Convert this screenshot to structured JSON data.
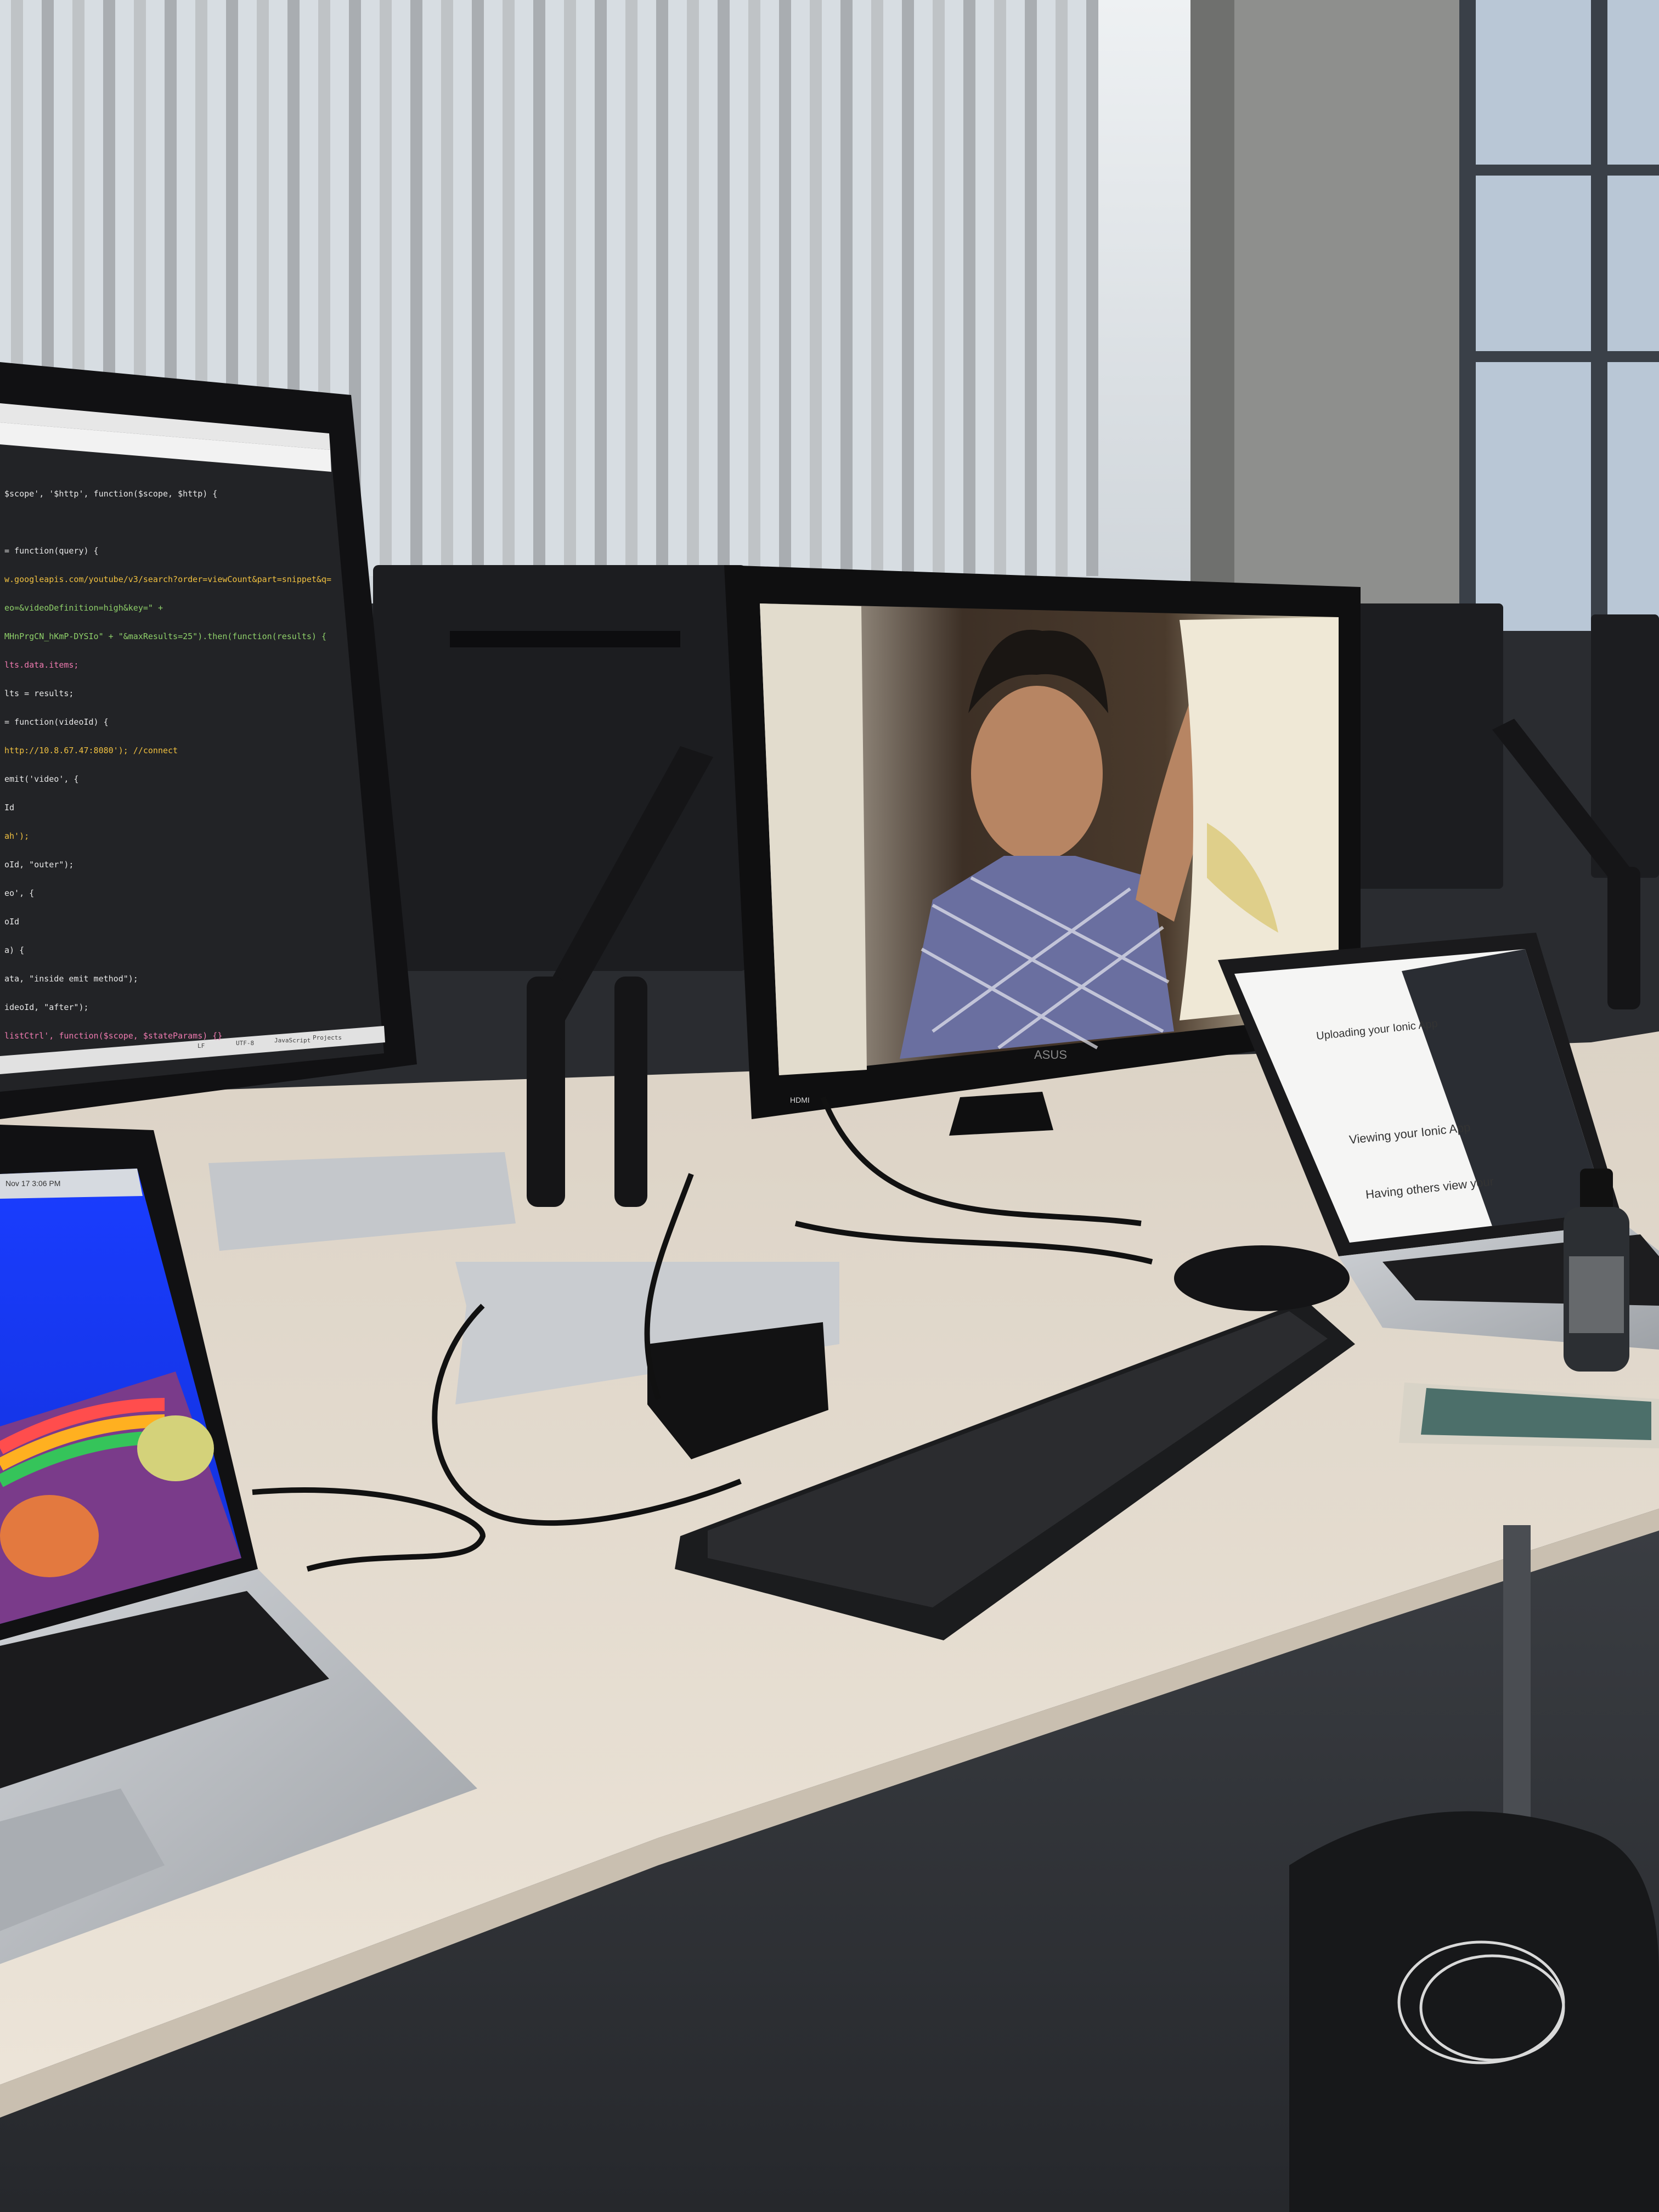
{
  "scene": {
    "description_colors": {
      "desk": "#e6ddd0",
      "wall": "#3a3c40",
      "window_light": "#e8ecef",
      "monitor_bezel": "#141414",
      "code_bg": "#222326",
      "laptop_silver": "#b9bcc0"
    }
  },
  "left_monitor": {
    "code_lines": [
      {
        "text": "$scope', '$http', function($scope, $http) {",
        "color": "#e8e8e8"
      },
      {
        "text": "",
        "color": "#7a7a7a"
      },
      {
        "text": "= function(query) {",
        "color": "#e8e8e8"
      },
      {
        "text": "w.googleapis.com/youtube/v3/search?order=viewCount&part=snippet&q=",
        "color": "#f0c040"
      },
      {
        "text": "eo=&videoDefinition=high&key=\" +",
        "color": "#8fd16a"
      },
      {
        "text": "MHnPrgCN_hKmP-DYSIo\" + \"&maxResults=25\").then(function(results) {",
        "color": "#8fd16a"
      },
      {
        "text": "lts.data.items;",
        "color": "#f07ab0"
      },
      {
        "text": "lts = results;",
        "color": "#e8e8e8"
      },
      {
        "text": "= function(videoId) {",
        "color": "#e8e8e8"
      },
      {
        "text": "http://10.8.67.47:8080'); //connect",
        "color": "#f0c040"
      },
      {
        "text": "emit('video', {",
        "color": "#e8e8e8"
      },
      {
        "text": "Id",
        "color": "#e8e8e8"
      },
      {
        "text": "ah');",
        "color": "#f0c040"
      },
      {
        "text": "oId, \"outer\");",
        "color": "#e8e8e8"
      },
      {
        "text": "eo', {",
        "color": "#e8e8e8"
      },
      {
        "text": "oId",
        "color": "#e8e8e8"
      },
      {
        "text": "a) {",
        "color": "#e8e8e8"
      },
      {
        "text": "ata, \"inside emit method\");",
        "color": "#e8e8e8"
      },
      {
        "text": "ideoId, \"after\");",
        "color": "#e8e8e8"
      },
      {
        "text": "listCtrl', function($scope, $stateParams) {}",
        "color": "#f07ab0"
      }
    ],
    "status_bar": [
      "LF",
      "UTF-8",
      "JavaScript",
      "Projects"
    ]
  },
  "right_laptop": {
    "doc_lines": [
      "Uploading your Ionic App",
      "Viewing your Ionic App",
      "Having others view your"
    ]
  },
  "left_laptop": {
    "menubar_time": "Nov 17  3:06 PM"
  },
  "center_monitor": {
    "brand": "ASUS",
    "port_label": "HDMI"
  }
}
